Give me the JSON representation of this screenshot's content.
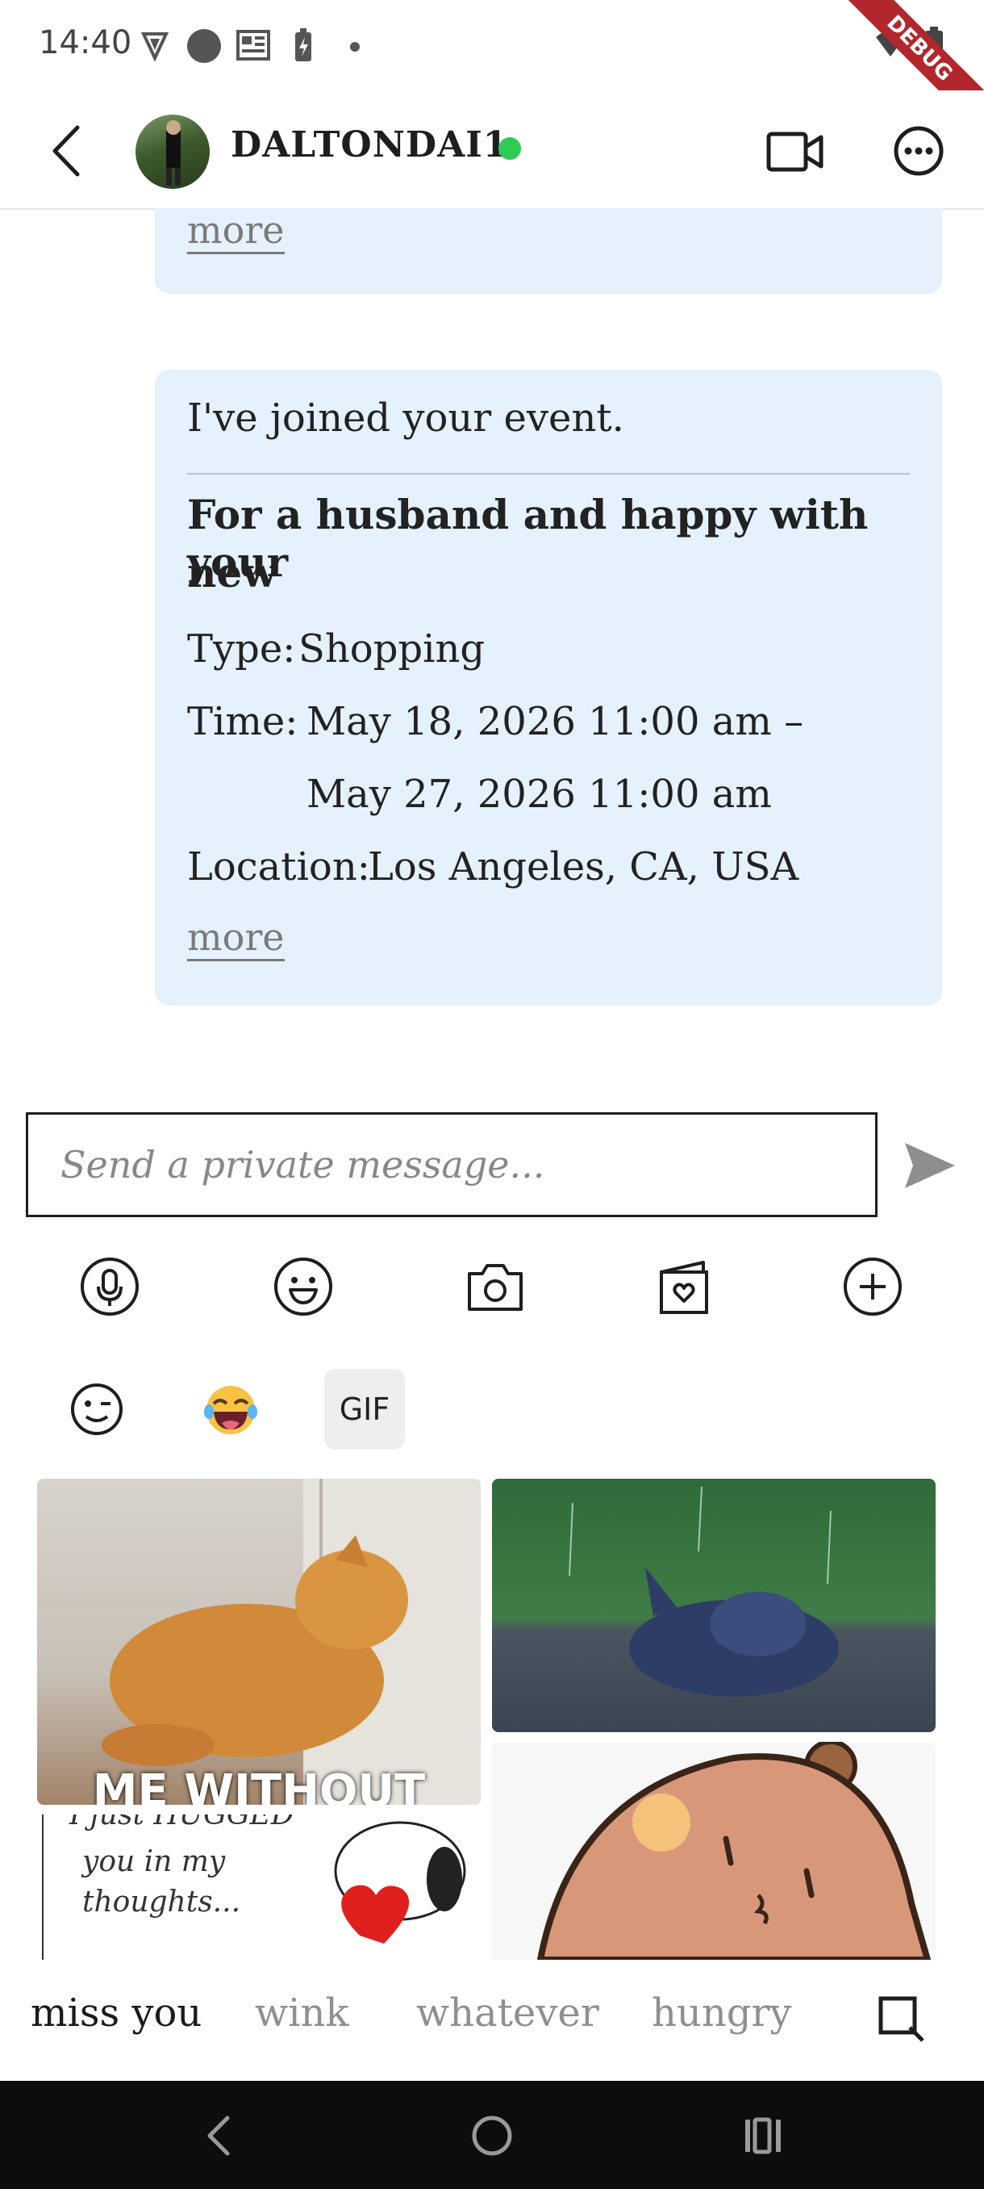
{
  "status_bar": {
    "time": "14:40",
    "debug_label": "DEBUG"
  },
  "header": {
    "username": "DALTONDAI1",
    "online": true
  },
  "messages": [
    {
      "type": "event_card_partial",
      "more_label": "more"
    },
    {
      "type": "event_card",
      "intro": "I've joined your event.",
      "title_line1": "For a husband and happy with your",
      "title_line2": "new",
      "type_label": "Type:",
      "type_value": "Shopping",
      "time_label": "Time:",
      "time_start": "May 18, 2026 11:00 am –",
      "time_end": "May 27, 2026 11:00 am",
      "location_label": "Location:",
      "location_value": "Los Angeles, CA, USA",
      "more_label": "more"
    }
  ],
  "composer": {
    "placeholder": "Send a private message..."
  },
  "toolbar": [
    "microphone-icon",
    "smiley-icon",
    "camera-icon",
    "gift-card-icon",
    "plus-icon"
  ],
  "emoji_tabs": {
    "gif_label": "GIF",
    "active": "GIF"
  },
  "gif_results": {
    "tile1_caption": "ME WITHOUT",
    "tile3_caption_line1": "I just HUGGED",
    "tile3_caption_line2": "you in my",
    "tile3_caption_line3": "thoughts..."
  },
  "gif_terms": [
    "miss you",
    "wink",
    "whatever",
    "hungry"
  ],
  "colors": {
    "card_bg": "#e5f1fd",
    "online": "#2ecc55",
    "accent_border": "#1e1e1e"
  }
}
